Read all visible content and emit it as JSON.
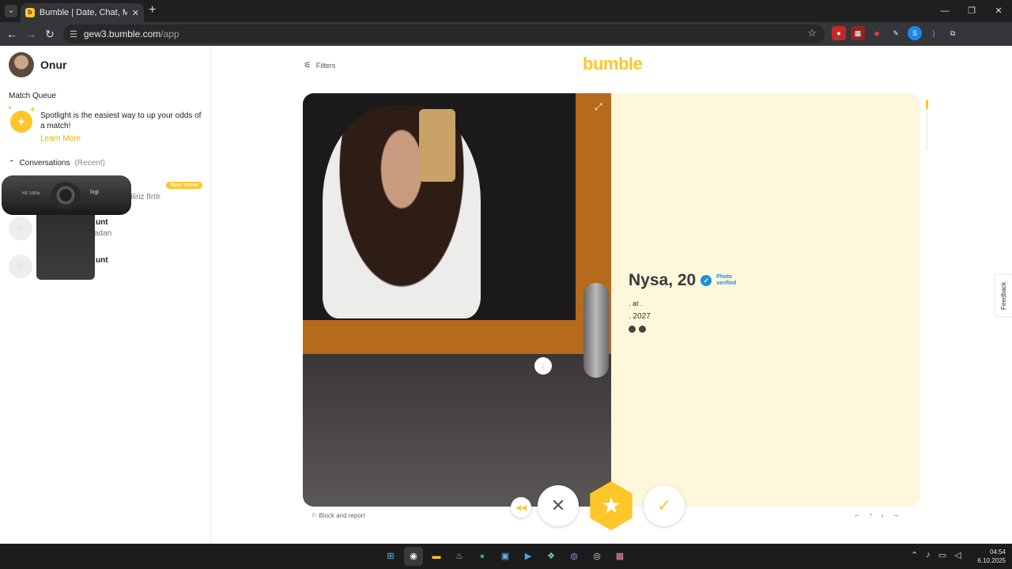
{
  "browser": {
    "tab_title": "Bumble | Date, Chat, Meet New",
    "tab_close": "✕",
    "new_tab": "+",
    "url_host": "gew3.bumble.com",
    "url_path": "/app",
    "window_controls": [
      "—",
      "❐",
      "✕"
    ]
  },
  "sidebar": {
    "user_name": "Onur",
    "match_queue_label": "Match Queue",
    "spotlight_text": "Spotlight is the easiest way to up your odds of a match!",
    "learn_more": "Learn More",
    "conversations_label": "Conversations",
    "conversations_recent": "(Recent)",
    "your_move_badge": "Your move",
    "conversations": [
      {
        "name": "",
        "message": "iyebiliriz fIrIIr"
      },
      {
        "name": "unt",
        "message": "adan"
      },
      {
        "name": "unt",
        "message": ""
      }
    ],
    "webcam_brand": "logi",
    "webcam_model": "HD 1080p"
  },
  "main": {
    "filters_label": "Filters",
    "logo": "bumble",
    "profile": {
      "name_age": "Nysa, 20",
      "photo_verified": "Photo verified",
      "line1": ". at .",
      "line2": ". 2027"
    },
    "block_report": "Block and report",
    "keyboard_hints": [
      "←",
      "↑",
      "↓",
      "→"
    ],
    "feedback": "Feedback"
  },
  "taskbar": {
    "time": "04:54",
    "date": "6.10.2025"
  },
  "colors": {
    "brand_yellow": "#ffc629",
    "card_bg": "#fef7db",
    "verified_blue": "#1a8fe3"
  }
}
